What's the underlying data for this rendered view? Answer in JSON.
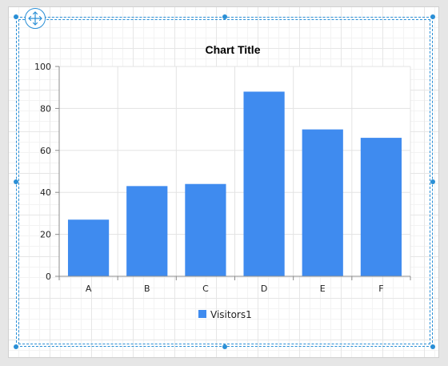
{
  "designer": {
    "selection_color": "#2a8fd6",
    "move_handle_icon": "move-arrows-icon"
  },
  "chart_data": {
    "type": "bar",
    "title": "Chart Title",
    "categories": [
      "A",
      "B",
      "C",
      "D",
      "E",
      "F"
    ],
    "series": [
      {
        "name": "Visitors1",
        "values": [
          27,
          43,
          44,
          88,
          70,
          66
        ],
        "color": "#3f8bef"
      }
    ],
    "xlabel": "",
    "ylabel": "",
    "ylim": [
      0,
      100
    ],
    "yticks": [
      "0",
      "20",
      "40",
      "60",
      "80",
      "100"
    ],
    "grid": true,
    "legend": "bottom-center"
  }
}
